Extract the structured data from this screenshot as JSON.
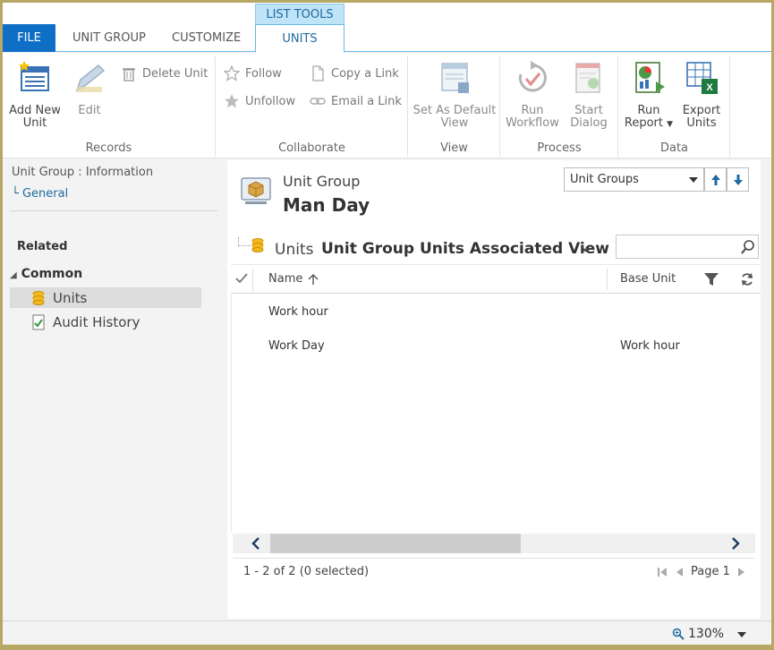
{
  "tabs": {
    "file": "FILE",
    "unit_group": "UNIT GROUP",
    "customize": "CUSTOMIZE",
    "context_header": "LIST TOOLS",
    "units": "UNITS"
  },
  "ribbon": {
    "records": {
      "label": "Records",
      "add_new_unit_1": "Add New",
      "add_new_unit_2": "Unit",
      "edit": "Edit",
      "delete_unit": "Delete Unit"
    },
    "collaborate": {
      "label": "Collaborate",
      "follow": "Follow",
      "unfollow": "Unfollow",
      "copy_link": "Copy a Link",
      "email_link": "Email a Link"
    },
    "view": {
      "label": "View",
      "set_default_1": "Set As Default",
      "set_default_2": "View"
    },
    "process": {
      "label": "Process",
      "run_workflow_1": "Run",
      "run_workflow_2": "Workflow",
      "start_dialog_1": "Start",
      "start_dialog_2": "Dialog"
    },
    "data": {
      "label": "Data",
      "run_report_1": "Run",
      "run_report_2": "Report",
      "export_units_1": "Export",
      "export_units_2": "Units"
    }
  },
  "nav": {
    "breadcrumb": "Unit Group : Information",
    "general": "General",
    "related": "Related",
    "common": "Common",
    "items": [
      {
        "label": "Units"
      },
      {
        "label": "Audit History"
      }
    ]
  },
  "record": {
    "entity": "Unit Group",
    "name": "Man Day",
    "selector": "Unit Groups"
  },
  "view": {
    "entity": "Units",
    "name": "Unit Group Units Associated View",
    "search_placeholder": ""
  },
  "grid": {
    "columns": {
      "name": "Name",
      "base_unit": "Base Unit"
    },
    "rows": [
      {
        "name": "Work hour",
        "base_unit": ""
      },
      {
        "name": "Work Day",
        "base_unit": "Work hour"
      }
    ],
    "status": "1 - 2 of 2 (0 selected)",
    "page": "Page 1"
  },
  "zoom": "130%",
  "colors": {
    "accent": "#0f6fc6",
    "link": "#1e6aa0",
    "context": "#bfe3f7"
  }
}
